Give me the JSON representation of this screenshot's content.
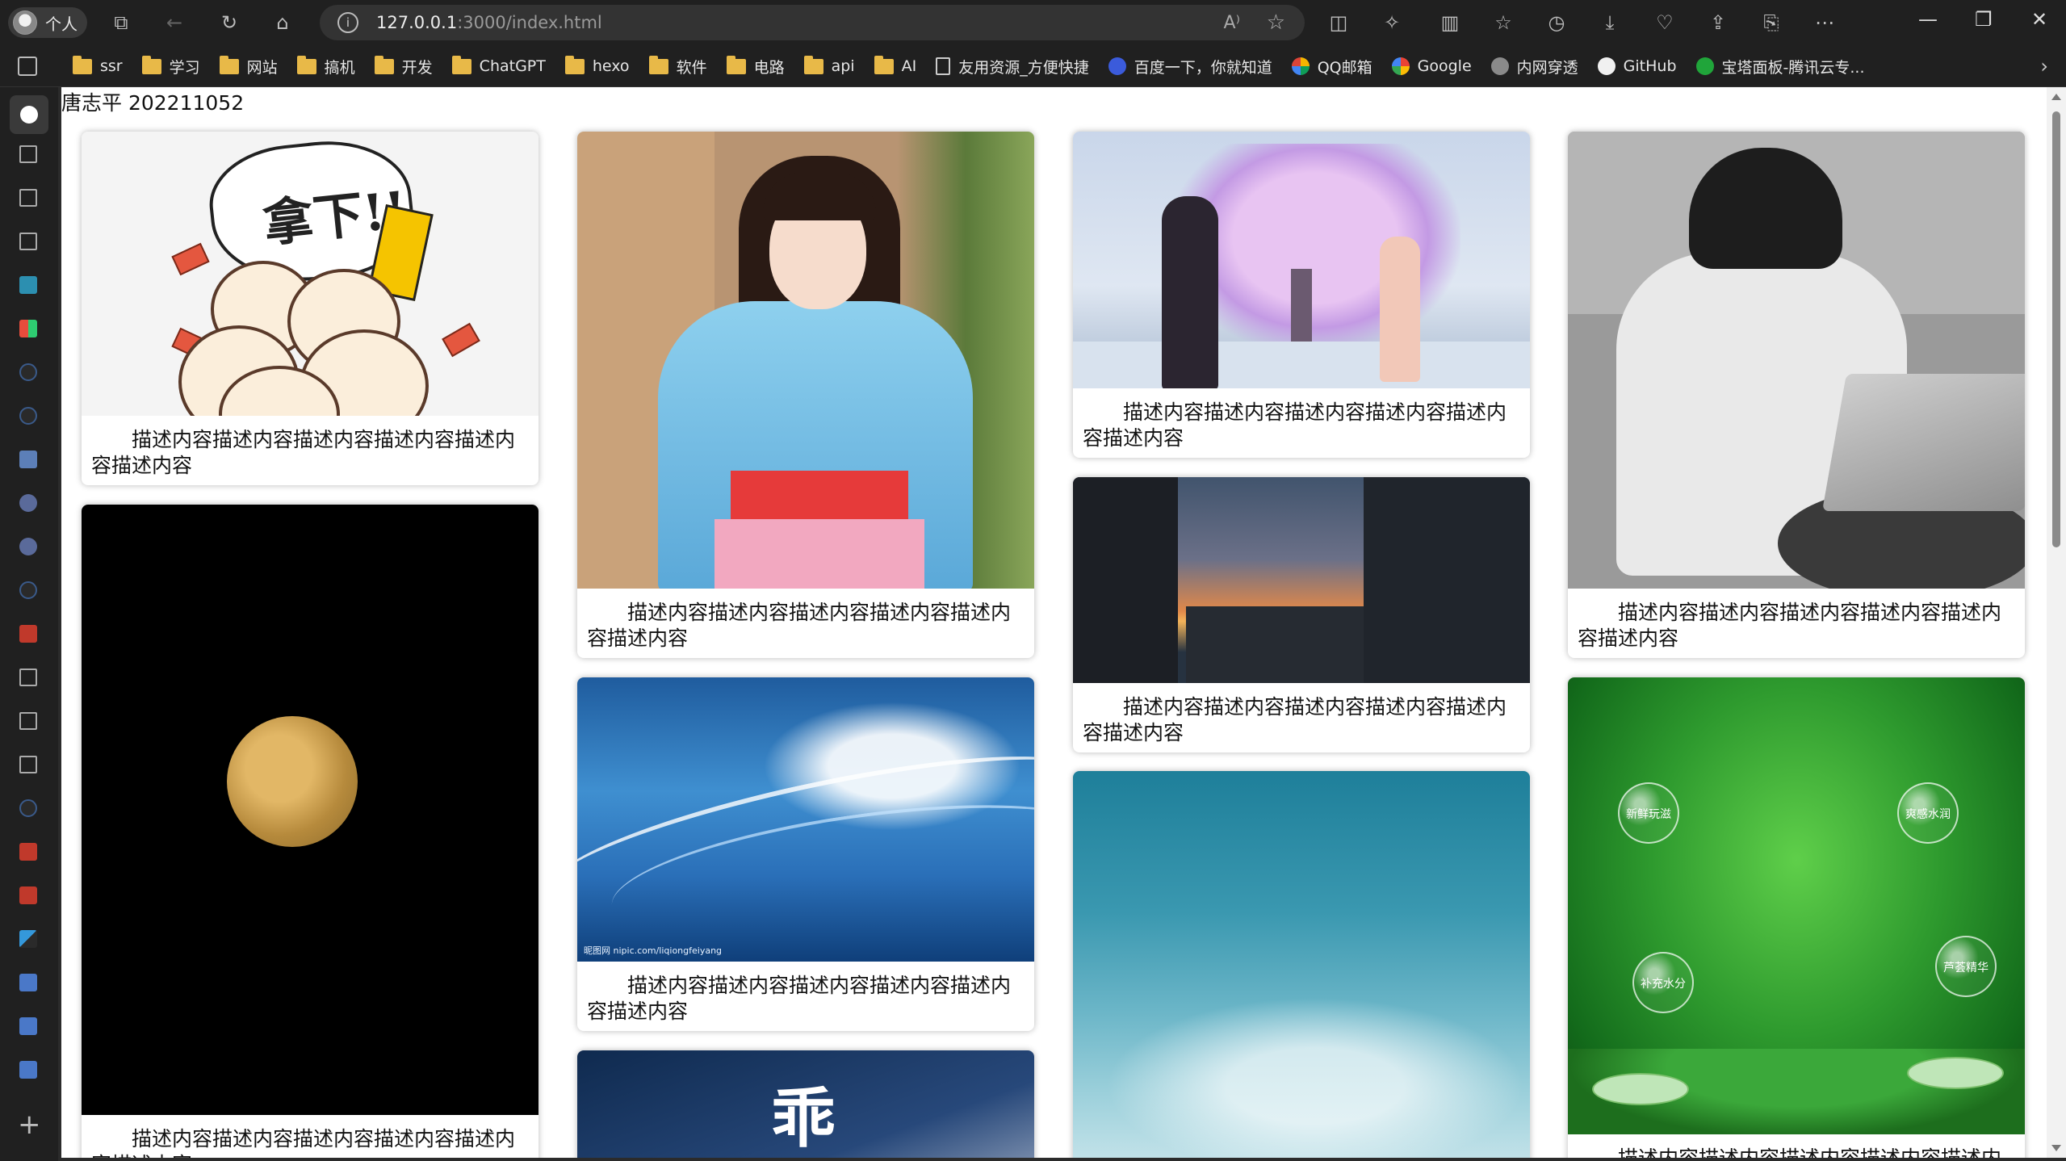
{
  "browser": {
    "profile_label": "个人",
    "url_host": "127.0.0.1",
    "url_rest": ":3000/index.html",
    "reader_icon": "A⁾",
    "bookmarks": [
      {
        "label": "ssr",
        "type": "folder"
      },
      {
        "label": "学习",
        "type": "folder"
      },
      {
        "label": "网站",
        "type": "folder"
      },
      {
        "label": "搞机",
        "type": "folder"
      },
      {
        "label": "开发",
        "type": "folder"
      },
      {
        "label": "ChatGPT",
        "type": "folder"
      },
      {
        "label": "hexo",
        "type": "folder"
      },
      {
        "label": "软件",
        "type": "folder"
      },
      {
        "label": "电路",
        "type": "folder"
      },
      {
        "label": "api",
        "type": "folder"
      },
      {
        "label": "AI",
        "type": "folder"
      },
      {
        "label": "友用资源_方便快捷",
        "type": "page"
      },
      {
        "label": "百度一下，你就知道",
        "type": "baidu"
      },
      {
        "label": "QQ邮箱",
        "type": "qq"
      },
      {
        "label": "Google",
        "type": "google"
      },
      {
        "label": "内网穿透",
        "type": "globe"
      },
      {
        "label": "GitHub",
        "type": "github"
      },
      {
        "label": "宝塔面板-腾讯云专...",
        "type": "bt"
      }
    ]
  },
  "page": {
    "student": "唐志平 202211052",
    "cards": [
      {
        "id": "c1",
        "desc": "描述内容描述内容描述内容描述内容描述内容描述内容",
        "art": "cartoon",
        "burst_text": "拿下!!"
      },
      {
        "id": "c2",
        "desc": "描述内容描述内容描述内容描述内容描述内容描述内容",
        "art": "moon"
      },
      {
        "id": "c3",
        "desc": "描述内容描述内容描述内容描述内容描述内容描述内容",
        "art": "girl"
      },
      {
        "id": "c4",
        "desc": "描述内容描述内容描述内容描述内容描述内容描述内容",
        "art": "wave",
        "watermark": "昵图网 nipic.com/liqiongfeiyang"
      },
      {
        "id": "c5",
        "desc": "",
        "art": "sign",
        "glyph": "乖"
      },
      {
        "id": "c6",
        "desc": "描述内容描述内容描述内容描述内容描述内容描述内容",
        "art": "anime"
      },
      {
        "id": "c7",
        "desc": "描述内容描述内容描述内容描述内容描述内容描述内容",
        "art": "sunset"
      },
      {
        "id": "c8",
        "desc": "",
        "art": "sky"
      },
      {
        "id": "c9",
        "desc": "描述内容描述内容描述内容描述内容描述内容描述内容",
        "art": "person"
      },
      {
        "id": "c10",
        "desc": "描述内容描述内容描述内容描述内容描述内容描述内容",
        "art": "green",
        "bubbles": [
          "新鲜玩滋",
          "爽感水润",
          "补充水分",
          "芦荟精华"
        ]
      }
    ]
  }
}
